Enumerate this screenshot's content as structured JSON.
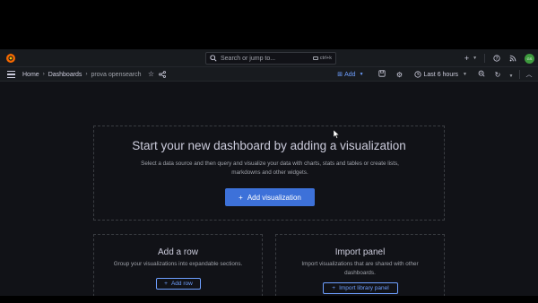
{
  "topbar": {
    "search_placeholder": "Search or jump to...",
    "search_shortcut": "ctrl+k",
    "plus_label": "+",
    "avatar_initials": "GS"
  },
  "navbar": {
    "breadcrumbs": [
      "Home",
      "Dashboards",
      "prova opensearch"
    ],
    "add_label": "Add",
    "time_range": "Last 6 hours"
  },
  "main_panel": {
    "title": "Start your new dashboard by adding a visualization",
    "description": "Select a data source and then query and visualize your data with charts, stats and tables or create lists, markdowns and other widgets.",
    "button_label": "Add visualization"
  },
  "row_panel": {
    "title": "Add a row",
    "description": "Group your visualizations into expandable sections.",
    "button_label": "Add row"
  },
  "import_panel": {
    "title": "Import panel",
    "description": "Import visualizations that are shared with other dashboards.",
    "button_label": "Import library panel"
  },
  "colors": {
    "background": "#111217",
    "bar": "#181b1f",
    "primary": "#3d71d9",
    "link": "#6e9fff",
    "logo_orange": "#f46800"
  }
}
